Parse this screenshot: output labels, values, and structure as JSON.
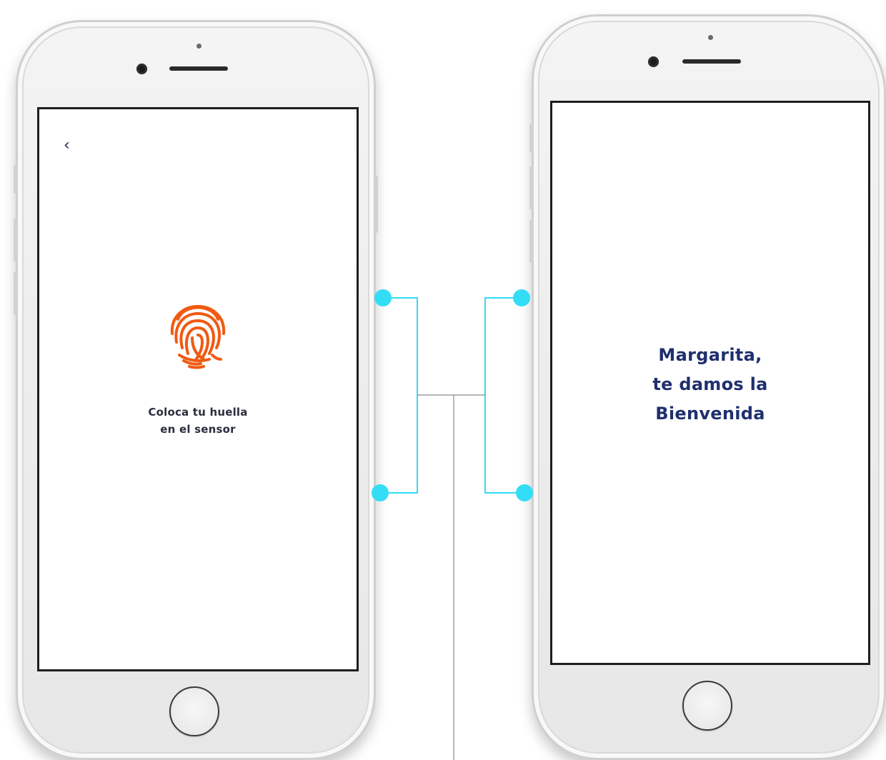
{
  "colors": {
    "connector_accent": "#33ddf5",
    "connector_neutral": "#8a8a8a",
    "fingerprint": "#f05a12",
    "instruction_text": "#2a2f3e",
    "welcome_text": "#1f2f6e"
  },
  "screen_left": {
    "back_icon": "chevron-left-icon",
    "back_glyph": "‹",
    "fingerprint_icon": "fingerprint-icon",
    "instruction_lines": [
      "Coloca tu huella",
      "en el sensor"
    ]
  },
  "screen_right": {
    "welcome_lines": [
      "Margarita,",
      "te damos la",
      "Bienvenida"
    ]
  }
}
